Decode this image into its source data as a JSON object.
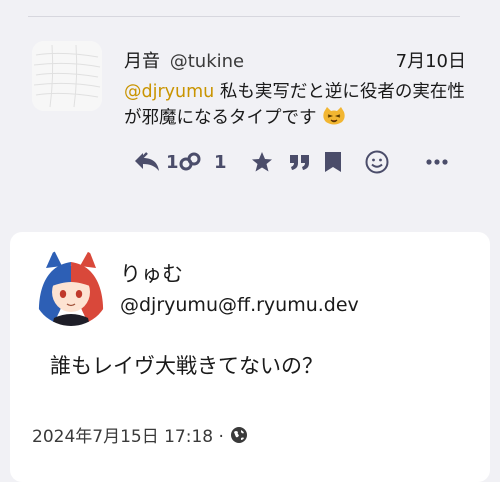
{
  "reply": {
    "author": "月音",
    "handle": "@tukine",
    "date": "7月10日",
    "mention": "@djryumu",
    "text": " 私も実写だと逆に役者の実在性が邪魔になるタイプです ",
    "emoji": "cat-face-emoji",
    "actions": {
      "reply_count": "1",
      "renote_count": "1"
    }
  },
  "post": {
    "author": "りゅむ",
    "handle": "@djryumu@ff.ryumu.dev",
    "text": "誰もレイヴ大戦きてないの？",
    "timestamp": "2024年7月15日 17:18 ·",
    "visibility_icon": "globe-icon"
  },
  "colors": {
    "background": "#f1f1f5",
    "card": "#ffffff",
    "mention": "#c99400",
    "action_icons": "#4b4d6a"
  }
}
